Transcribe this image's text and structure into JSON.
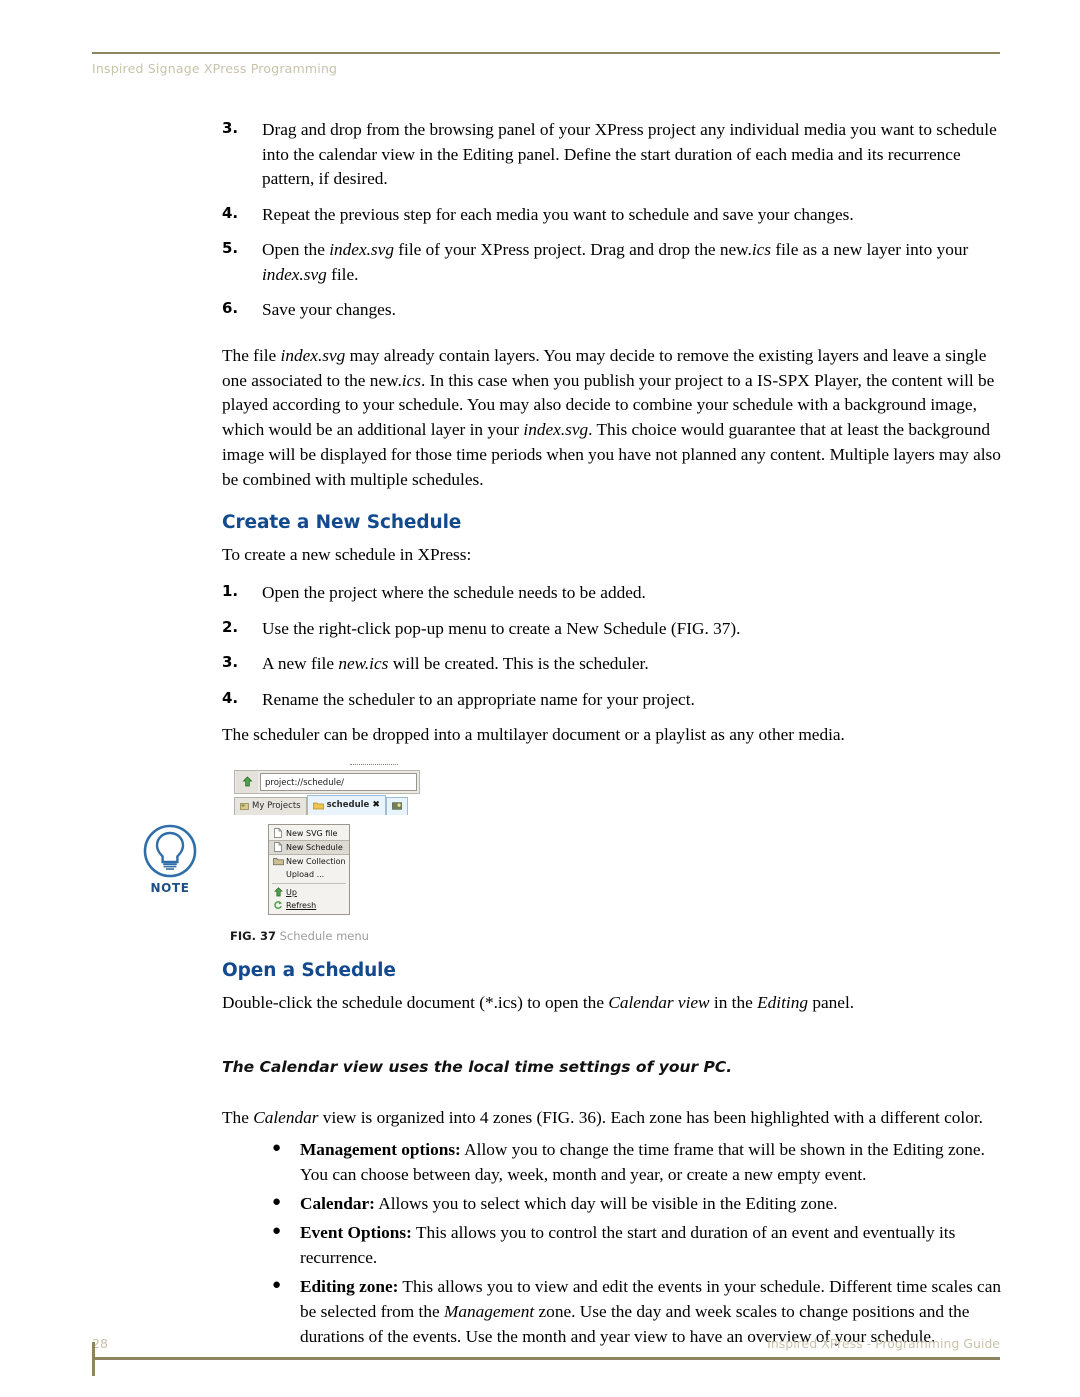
{
  "header": {
    "running_head": "Inspired Signage XPress Programming"
  },
  "steps_top": [
    {
      "num": "3.",
      "text_html": "Drag and drop from the browsing panel of your XPress project any individual media you want to schedule into the calendar view in the Editing panel. Define the start duration of each media and its recurrence pattern, if desired."
    },
    {
      "num": "4.",
      "text_html": "Repeat the previous step for each media you want to schedule and save your changes."
    },
    {
      "num": "5.",
      "text_html": "Open the <i>index.svg</i> file of your XPress project. Drag and drop the new.<i>ics</i> file as a new layer into your <i>index.svg</i> file."
    },
    {
      "num": "6.",
      "text_html": "Save your changes."
    }
  ],
  "paragraph_layers": "The file <i>index.svg</i> may already contain layers. You may decide to remove the existing layers and leave a single one associated to the new.<i>ics</i>. In this case when you publish your project to a IS-SPX Player, the content will be played according to your schedule. You may also decide to combine your schedule with a background image, which would be an additional layer in your <i>index.svg</i>. This choice would guarantee that at least the background image will be displayed for those time periods when you have not planned any content. Multiple layers may also be combined with multiple schedules.",
  "create_schedule": {
    "heading": "Create a New Schedule",
    "intro": "To create a new schedule in XPress:",
    "steps": [
      {
        "num": "1.",
        "text_html": "Open the project where the schedule needs to be added."
      },
      {
        "num": "2.",
        "text_html": "Use the right-click pop-up menu to create a New Schedule (FIG. 37)."
      },
      {
        "num": "3.",
        "text_html": "A new file <i>new.ics</i> will be created. This is the scheduler."
      },
      {
        "num": "4.",
        "text_html": "Rename the scheduler to an appropriate name for your project."
      }
    ],
    "outro": "The scheduler can be dropped into a multilayer document or a playlist as any other media."
  },
  "figure": {
    "address_value": "project://schedule/",
    "tabs": [
      {
        "label": "My Projects",
        "active": false
      },
      {
        "label": "schedule",
        "active": true,
        "close": "✖"
      }
    ],
    "menu_items": [
      {
        "label": "New SVG file",
        "icon": "file-icon",
        "selected": false
      },
      {
        "label": "New Schedule",
        "icon": "file-icon",
        "selected": true
      },
      {
        "label": "New Collection",
        "icon": "folder-icon",
        "selected": false
      },
      {
        "label": "Upload ...",
        "icon": "none",
        "selected": false
      },
      {
        "label": "Up",
        "icon": "up-arrow-icon",
        "selected": false,
        "accel": "U"
      },
      {
        "label": "Refresh",
        "icon": "refresh-icon",
        "selected": false,
        "accel": "R"
      }
    ],
    "caption_number": "FIG. 37",
    "caption_text": "Schedule menu"
  },
  "open_schedule": {
    "heading": "Open a Schedule",
    "paragraph_html": "Double-click the schedule document (*.ics) to open the <i>Calendar view</i> in the <i>Editing</i> panel."
  },
  "note": {
    "label": "NOTE",
    "text": "The Calendar view uses the local time settings of your PC."
  },
  "zones": {
    "intro_html": "The <i>Calendar</i> view is organized into 4 zones (FIG. 36). Each zone has been highlighted with a different color.",
    "bullets": [
      {
        "dot": "●",
        "text_html": "<b>Management options:</b> Allow you to change the time frame that will be shown in the Editing zone. You can choose between day, week, month and year, or create a new empty event."
      },
      {
        "dot": "●",
        "text_html": "<b>Calendar:</b> Allows you to select which day will be visible in the Editing zone."
      },
      {
        "dot": "●",
        "text_html": "<b>Event Options:</b> This allows you to control the start and duration of an event and eventually its recurrence."
      },
      {
        "dot": "●",
        "text_html": "<b>Editing zone:</b> This allows you to view and edit the events in your schedule. Different time scales can be selected from the <i>Management</i> zone. Use the day and week scales to change positions and the durations of the events. Use the month and year view to have an overview of your schedule."
      }
    ]
  },
  "footer": {
    "page_number": "28",
    "guide_title": "Inspired XPress - Programming Guide"
  },
  "colors": {
    "heading_blue": "#134a8e",
    "rule_olive": "#8c8560",
    "header_text": "#c9c3ab",
    "note_blue": "#1f4f83"
  }
}
